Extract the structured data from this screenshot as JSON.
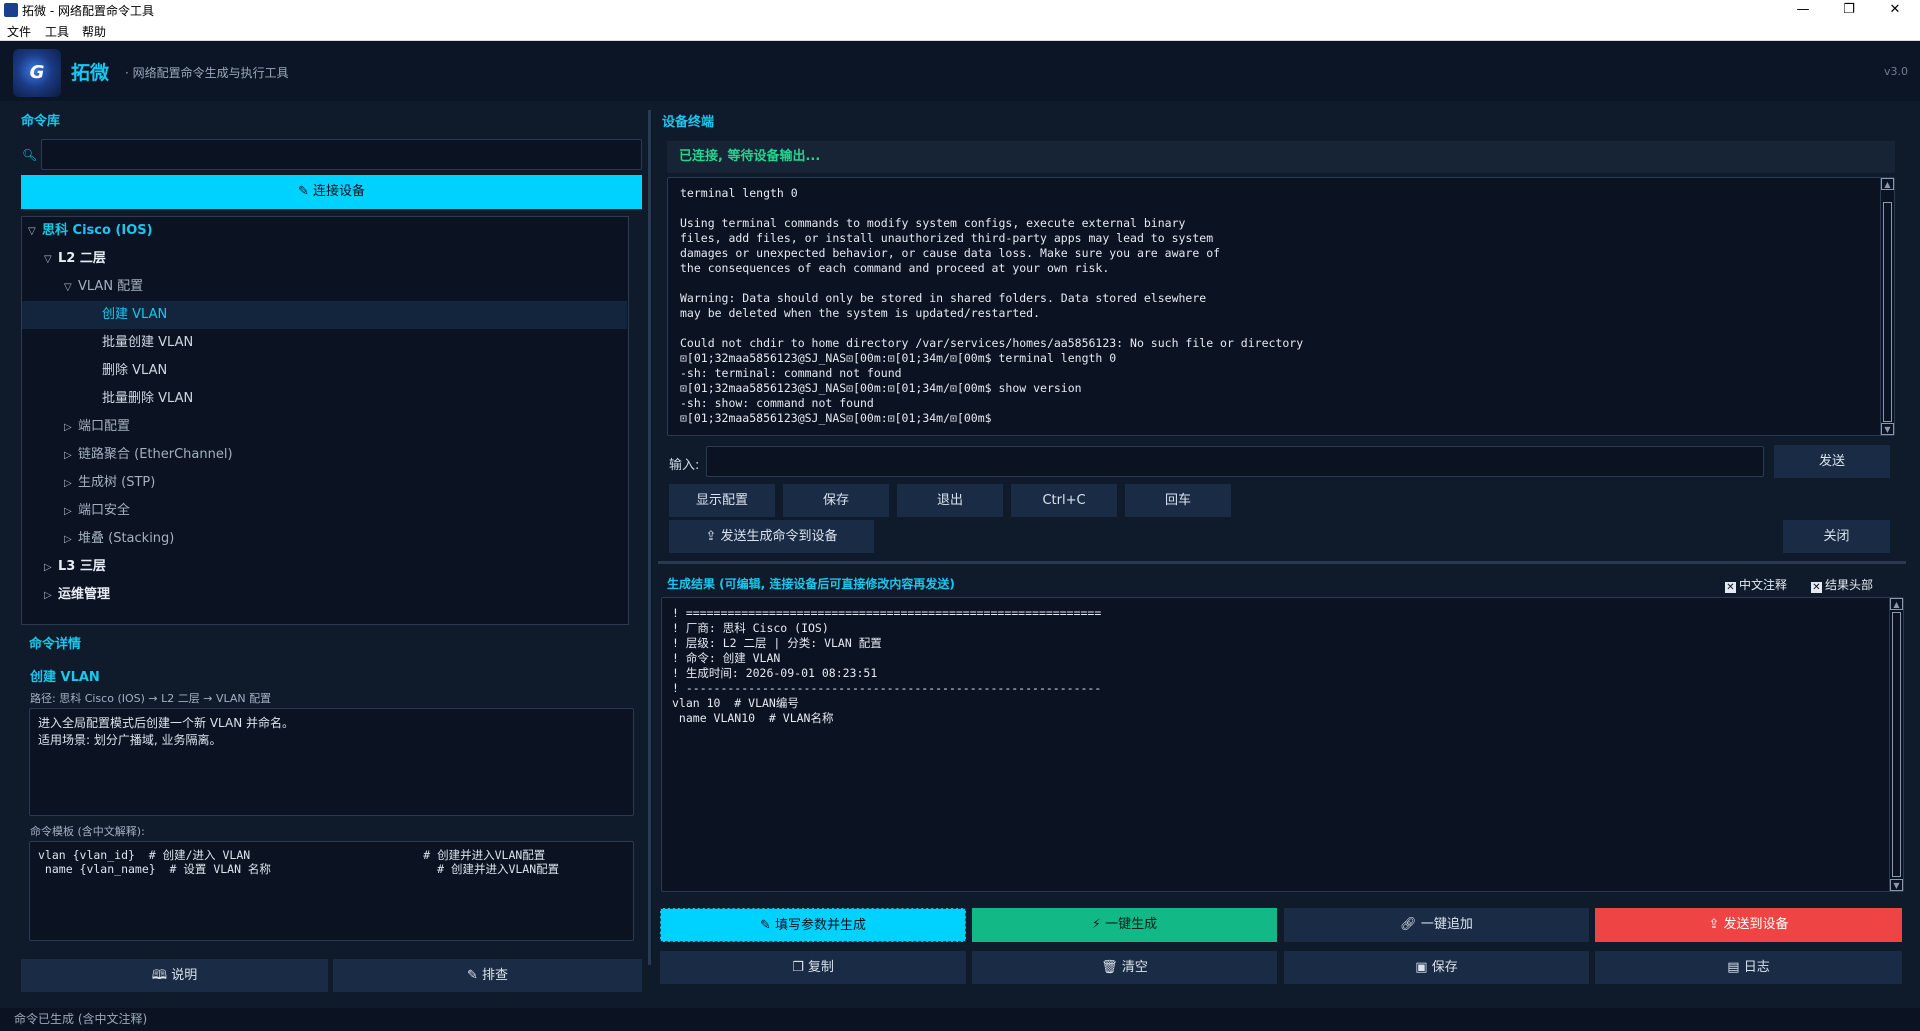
{
  "window": {
    "title": "拓微 - 网络配置命令工具",
    "minimize_icon": "minimize-icon",
    "maximize_icon": "maximize-icon",
    "close_icon": "close-icon"
  },
  "menubar": {
    "items": [
      "文件",
      "工具",
      "帮助"
    ]
  },
  "header": {
    "logo_text": "G",
    "brand": "拓微",
    "subtitle": "· 网络配置命令生成与执行工具",
    "version": "v3.0"
  },
  "library": {
    "title": "命令库",
    "search_placeholder": "",
    "connect_label": "连接设备",
    "tree": [
      {
        "label": "思科 Cisco (IOS)",
        "arrow": "▽",
        "level": 0,
        "kind": "vendor"
      },
      {
        "label": "L2 二层",
        "arrow": "▽",
        "level": 1,
        "kind": "l1"
      },
      {
        "label": "VLAN 配置",
        "arrow": "▽",
        "level": 2,
        "kind": "dim"
      },
      {
        "label": "创建 VLAN",
        "arrow": "",
        "level": 3,
        "kind": "sel"
      },
      {
        "label": "批量创建 VLAN",
        "arrow": "",
        "level": 3,
        "kind": ""
      },
      {
        "label": "删除 VLAN",
        "arrow": "",
        "level": 3,
        "kind": ""
      },
      {
        "label": "批量删除 VLAN",
        "arrow": "",
        "level": 3,
        "kind": ""
      },
      {
        "label": "端口配置",
        "arrow": "▷",
        "level": 2,
        "kind": "dim"
      },
      {
        "label": "链路聚合 (EtherChannel)",
        "arrow": "▷",
        "level": 2,
        "kind": "dim"
      },
      {
        "label": "生成树 (STP)",
        "arrow": "▷",
        "level": 2,
        "kind": "dim"
      },
      {
        "label": "端口安全",
        "arrow": "▷",
        "level": 2,
        "kind": "dim"
      },
      {
        "label": "堆叠 (Stacking)",
        "arrow": "▷",
        "level": 2,
        "kind": "dim"
      },
      {
        "label": "L3 三层",
        "arrow": "▷",
        "level": 1,
        "kind": "l1"
      },
      {
        "label": "运维管理",
        "arrow": "▷",
        "level": 1,
        "kind": "l1"
      }
    ]
  },
  "detail": {
    "title": "命令详情",
    "name": "创建 VLAN",
    "path": "路径: 思科 Cisco (IOS) → L2 二层 → VLAN 配置",
    "description": "进入全局配置模式后创建一个新 VLAN 并命名。\n适用场景: 划分广播域, 业务隔离。",
    "template_label": "命令模板 (含中文解释):",
    "template": "vlan {vlan_id}  # 创建/进入 VLAN                         # 创建并进入VLAN配置\n name {vlan_name}  # 设置 VLAN 名称                        # 创建并进入VLAN配置",
    "help_label": "说明",
    "troubleshoot_label": "排查"
  },
  "terminal": {
    "title": "设备终端",
    "status": "已连接, 等待设备输出...",
    "output": "terminal length 0\n\nUsing terminal commands to modify system configs, execute external binary\nfiles, add files, or install unauthorized third-party apps may lead to system\ndamages or unexpected behavior, or cause data loss. Make sure you are aware of\nthe consequences of each command and proceed at your own risk.\n\nWarning: Data should only be stored in shared folders. Data stored elsewhere\nmay be deleted when the system is updated/restarted.\n\nCould not chdir to home directory /var/services/homes/aa5856123: No such file or directory\n⊡[01;32maa5856123@SJ_NAS⊡[00m:⊡[01;34m/⊡[00m$ terminal length 0\n-sh: terminal: command not found\n⊡[01;32maa5856123@SJ_NAS⊡[00m:⊡[01;34m/⊡[00m$ show version\n-sh: show: command not found\n⊡[01;32maa5856123@SJ_NAS⊡[00m:⊡[01;34m/⊡[00m$",
    "input_label": "输入:",
    "input_value": "",
    "send_label": "发送",
    "quick": [
      "显示配置",
      "保存",
      "退出",
      "Ctrl+C",
      "回车"
    ],
    "send_generated_label": "发送生成命令到设备",
    "close_label": "关闭"
  },
  "result": {
    "title": "生成结果 (可编辑, 连接设备后可直接修改内容再发送)",
    "chk_cn": "中文注释",
    "chk_header": "结果头部",
    "text": "! ============================================================\n! 厂商: 思科 Cisco (IOS)\n! 层级: L2 二层 | 分类: VLAN 配置\n! 命令: 创建 VLAN\n! 生成时间: 2026-09-01 08:23:51\n! ------------------------------------------------------------\nvlan 10  # VLAN编号\n name VLAN10  # VLAN名称",
    "fill_label": "填写参数并生成",
    "gen_label": "一键生成",
    "append_label": "一键追加",
    "send_label": "发送到设备",
    "copy_label": "复制",
    "clear_label": "清空",
    "save_label": "保存",
    "log_label": "日志"
  },
  "statusbar": {
    "text": "命令已生成 (含中文注释)"
  },
  "colors": {
    "accent": "#19c7ef",
    "primary_button": "#00d2ff",
    "success": "#12b886",
    "danger": "#ef4444",
    "status_green": "#22d68c"
  }
}
